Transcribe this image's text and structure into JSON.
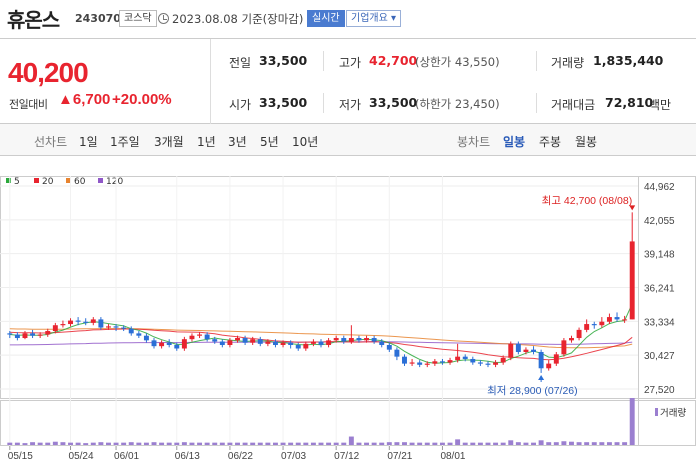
{
  "header": {
    "name": "휴온스",
    "code": "243070",
    "market": "코스닥",
    "date_text": "2023.08.08 기준(장마감)",
    "realtime_label": "실시간",
    "overview_label": "기업개요 ▾"
  },
  "summary": {
    "price": "40,200",
    "change_label": "전일대비",
    "change_value": "▲6,700",
    "change_pct": "+20.00%",
    "prev_close_label": "전일",
    "prev_close": "33,500",
    "open_label": "시가",
    "open": "33,500",
    "high_label": "고가",
    "high": "42,700",
    "upper_limit": "(상한가 43,550)",
    "low_label": "저가",
    "low": "33,500",
    "lower_limit": "(하한가 23,450)",
    "volume_label": "거래량",
    "volume": "1,835,440",
    "amount_label": "거래대금",
    "amount": "72,810",
    "amount_unit": "백만"
  },
  "tabs": {
    "line_chart": "선차트",
    "periods": [
      "1일",
      "1주일",
      "3개월",
      "1년",
      "3년",
      "5년",
      "10년"
    ],
    "candle_label": "봉차트",
    "candle_options": [
      "일봉",
      "주봉",
      "월봉"
    ],
    "active_candle": "일봉"
  },
  "colors": {
    "up": "#e8242f",
    "down": "#2b6fd6",
    "ma5": "#2aa83a",
    "ma20": "#e8242f",
    "ma60": "#e8842f",
    "ma120": "#9058c8"
  },
  "chart_data": {
    "type": "candlestick",
    "legend": [
      {
        "name": "5",
        "color": "#2aa83a"
      },
      {
        "name": "20",
        "color": "#e8242f"
      },
      {
        "name": "60",
        "color": "#e8842f"
      },
      {
        "name": "120",
        "color": "#9058c8"
      }
    ],
    "y_ticks": [
      "44,962",
      "42,055",
      "39,148",
      "36,241",
      "33,334",
      "30,427",
      "27,520"
    ],
    "ylim": [
      27520,
      44962
    ],
    "x_labels": [
      "05/15",
      "05/24",
      "06/01",
      "06/13",
      "06/22",
      "07/03",
      "07/12",
      "07/21",
      "08/01"
    ],
    "high_annotation": "최고 42,700 (08/08)",
    "low_annotation": "최저 28,900 (07/26)",
    "volume_label": "거래량",
    "candles": [
      [
        32300,
        32200,
        32500,
        31900
      ],
      [
        32200,
        31900,
        32400,
        31700
      ],
      [
        31900,
        32300,
        32500,
        31800
      ],
      [
        32300,
        32100,
        32600,
        31900
      ],
      [
        32100,
        32200,
        32400,
        31900
      ],
      [
        32200,
        32500,
        32700,
        32000
      ],
      [
        32500,
        33000,
        33200,
        32300
      ],
      [
        33000,
        33100,
        33400,
        32800
      ],
      [
        33100,
        33400,
        33600,
        32900
      ],
      [
        33400,
        33300,
        33700,
        33000
      ],
      [
        33300,
        33200,
        33600,
        33000
      ],
      [
        33200,
        33500,
        33700,
        33000
      ],
      [
        33500,
        32800,
        33700,
        32600
      ],
      [
        32800,
        32900,
        33100,
        32600
      ],
      [
        32900,
        32800,
        33100,
        32500
      ],
      [
        32800,
        32700,
        33000,
        32500
      ],
      [
        32700,
        32300,
        32900,
        32100
      ],
      [
        32300,
        32100,
        32500,
        31900
      ],
      [
        32100,
        31700,
        32300,
        31500
      ],
      [
        31700,
        31200,
        31900,
        31000
      ],
      [
        31200,
        31500,
        31700,
        31000
      ],
      [
        31500,
        31300,
        31800,
        31100
      ],
      [
        31300,
        31000,
        31500,
        30800
      ],
      [
        31000,
        31800,
        32000,
        30800
      ],
      [
        31800,
        32100,
        32300,
        31600
      ],
      [
        32100,
        32200,
        32400,
        31900
      ],
      [
        32200,
        31800,
        32400,
        31600
      ],
      [
        31800,
        31600,
        32000,
        31400
      ],
      [
        31600,
        31300,
        31800,
        31100
      ],
      [
        31300,
        31700,
        31900,
        31100
      ],
      [
        31700,
        31900,
        32100,
        31500
      ],
      [
        31900,
        31500,
        32100,
        31300
      ],
      [
        31500,
        31800,
        32000,
        31300
      ],
      [
        31800,
        31400,
        32000,
        31200
      ],
      [
        31400,
        31600,
        31800,
        31200
      ],
      [
        31600,
        31300,
        31800,
        31100
      ],
      [
        31300,
        31500,
        31700,
        31100
      ],
      [
        31500,
        31300,
        31700,
        31000
      ],
      [
        31300,
        31000,
        31500,
        30800
      ],
      [
        31000,
        31400,
        31600,
        30800
      ],
      [
        31400,
        31600,
        31800,
        31200
      ],
      [
        31600,
        31300,
        31800,
        31100
      ],
      [
        31300,
        31700,
        31900,
        31100
      ],
      [
        31700,
        31900,
        32100,
        31500
      ],
      [
        31900,
        31600,
        32100,
        31400
      ],
      [
        31600,
        31900,
        33000,
        31400
      ],
      [
        31900,
        31700,
        32100,
        31500
      ],
      [
        31700,
        31900,
        32100,
        31500
      ],
      [
        31900,
        31600,
        32100,
        31400
      ],
      [
        31600,
        31300,
        31800,
        31100
      ],
      [
        31300,
        30900,
        31500,
        30700
      ],
      [
        30900,
        30300,
        31100,
        30000
      ],
      [
        30300,
        29700,
        30500,
        29500
      ],
      [
        29700,
        29800,
        30100,
        29500
      ],
      [
        29800,
        29600,
        30000,
        29400
      ],
      [
        29600,
        29700,
        29900,
        29400
      ],
      [
        29700,
        29900,
        30100,
        29500
      ],
      [
        29900,
        29800,
        30100,
        29600
      ],
      [
        29800,
        30000,
        30200,
        29600
      ],
      [
        30000,
        30300,
        31400,
        29800
      ],
      [
        30300,
        30100,
        30500,
        29900
      ],
      [
        30100,
        29800,
        30300,
        29600
      ],
      [
        29800,
        29700,
        30000,
        29500
      ],
      [
        29700,
        29600,
        29900,
        29400
      ],
      [
        29600,
        29800,
        30000,
        29400
      ],
      [
        29800,
        30200,
        30400,
        29600
      ],
      [
        30200,
        31400,
        31600,
        30000
      ],
      [
        31400,
        30700,
        31600,
        30500
      ],
      [
        30700,
        30900,
        31100,
        30500
      ],
      [
        30900,
        30700,
        31200,
        30500
      ],
      [
        30700,
        29300,
        30900,
        28900
      ],
      [
        29300,
        29700,
        30000,
        29100
      ],
      [
        29700,
        30500,
        30700,
        29500
      ],
      [
        30500,
        31700,
        31900,
        30300
      ],
      [
        31700,
        31900,
        32100,
        31500
      ],
      [
        31900,
        32600,
        32800,
        31700
      ],
      [
        32600,
        33100,
        33500,
        32400
      ],
      [
        33100,
        33000,
        33300,
        32700
      ],
      [
        33000,
        33300,
        33700,
        32800
      ],
      [
        33300,
        33700,
        34000,
        33100
      ],
      [
        33700,
        33500,
        34100,
        33300
      ],
      [
        33500,
        33500,
        33800,
        33200
      ],
      [
        33500,
        40200,
        42700,
        33500
      ]
    ],
    "volume": [
      5,
      5,
      4,
      6,
      5,
      5,
      7,
      6,
      5,
      5,
      4,
      5,
      6,
      5,
      5,
      5,
      6,
      5,
      5,
      6,
      5,
      5,
      5,
      6,
      5,
      5,
      5,
      5,
      5,
      5,
      5,
      5,
      5,
      5,
      5,
      5,
      5,
      5,
      5,
      5,
      5,
      5,
      5,
      5,
      5,
      18,
      5,
      5,
      5,
      5,
      6,
      6,
      6,
      5,
      5,
      5,
      5,
      5,
      5,
      12,
      5,
      5,
      5,
      5,
      5,
      5,
      10,
      6,
      5,
      5,
      10,
      6,
      6,
      8,
      7,
      6,
      6,
      6,
      6,
      6,
      6,
      6,
      100
    ]
  }
}
